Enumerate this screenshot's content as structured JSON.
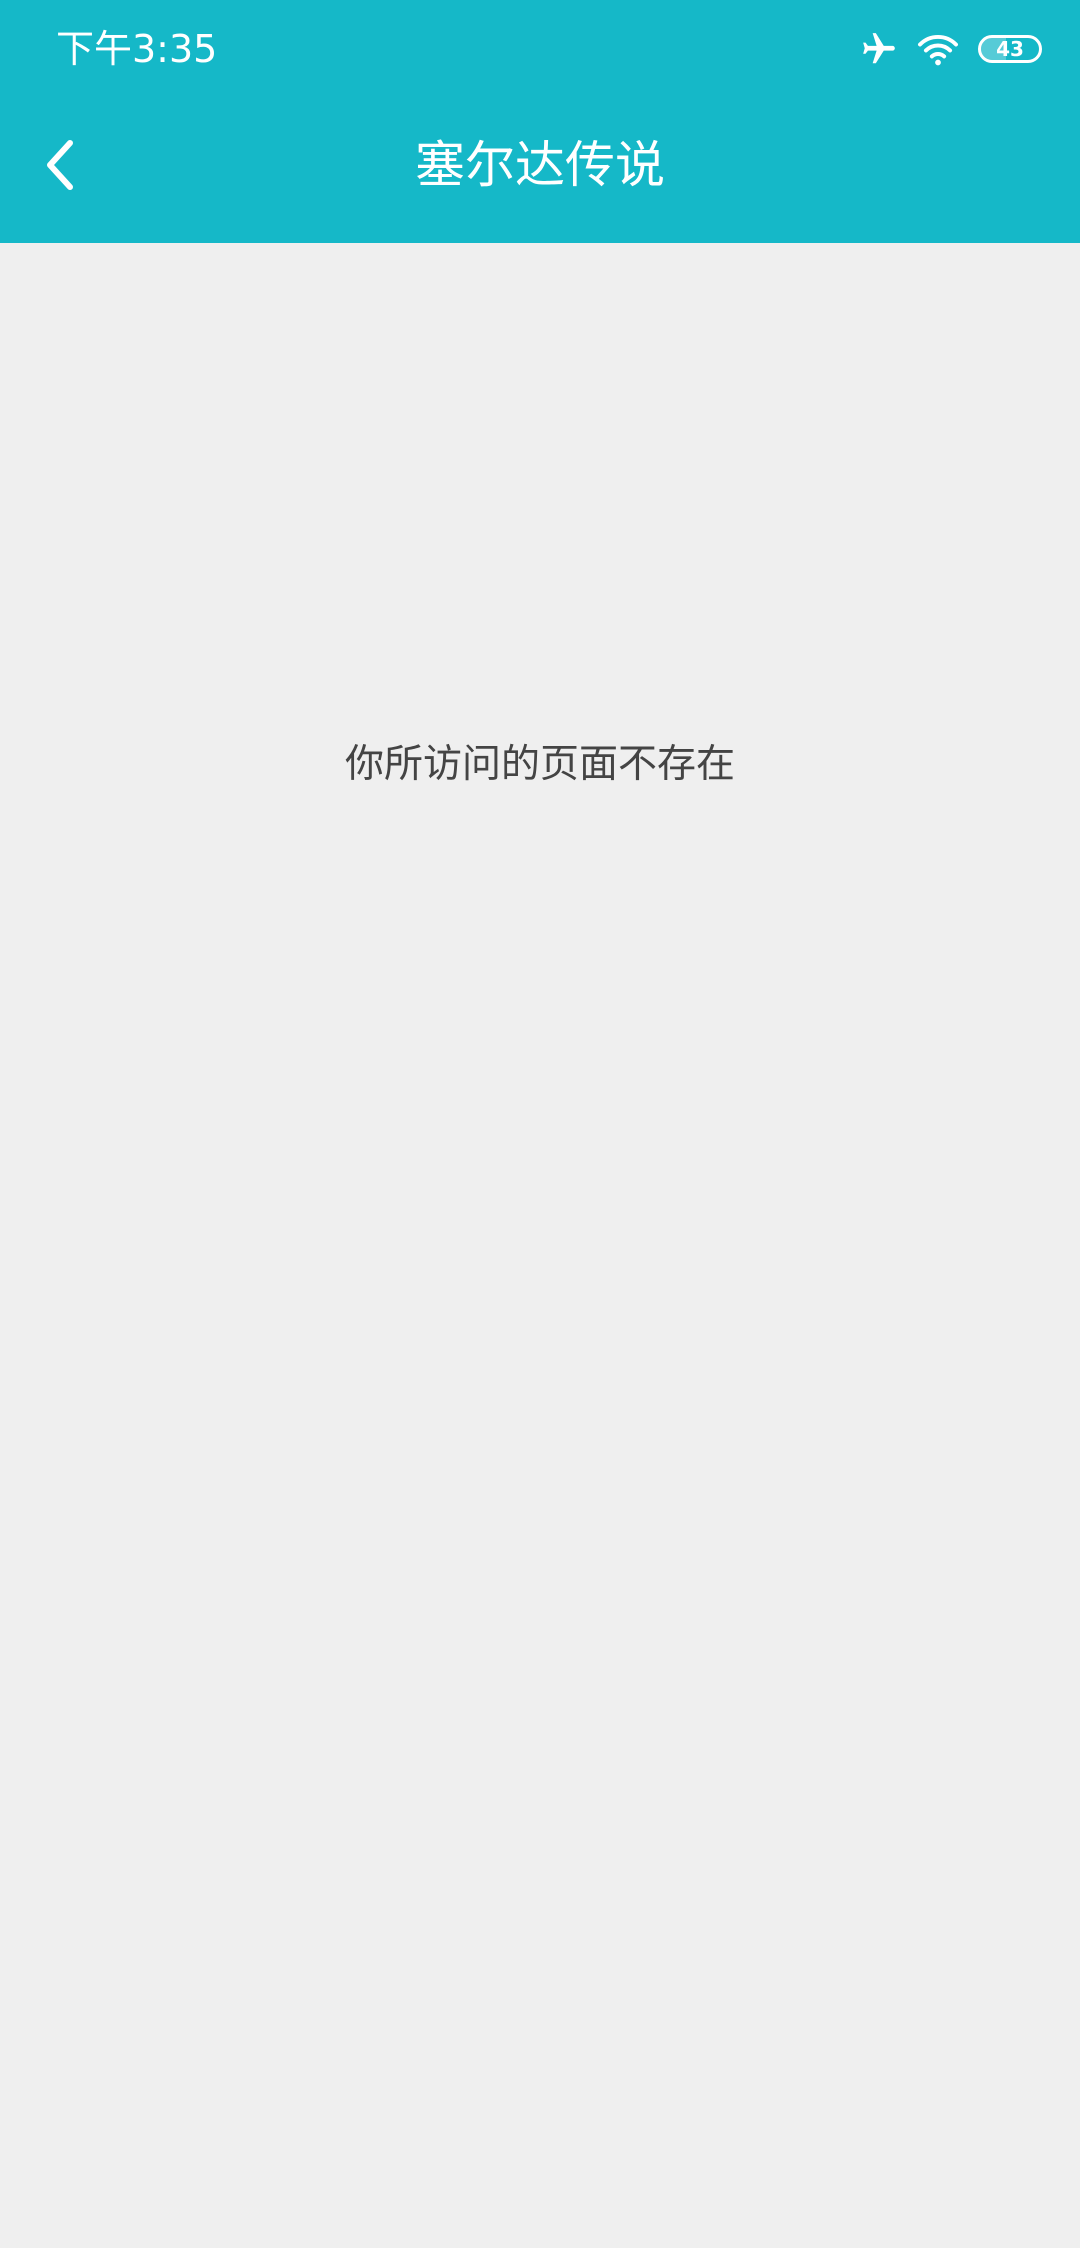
{
  "status_bar": {
    "time": "下午3:35",
    "battery_level": "43",
    "battery_fraction": 0.43,
    "icons": [
      "airplane-mode-icon",
      "wifi-icon",
      "battery-icon"
    ]
  },
  "nav": {
    "title": "塞尔达传说",
    "back_icon": "chevron-left-icon"
  },
  "content": {
    "message": "你所访问的页面不存在"
  },
  "colors": {
    "header_bg": "#15b8c8",
    "page_bg": "#efefef",
    "message_text": "#444444"
  }
}
